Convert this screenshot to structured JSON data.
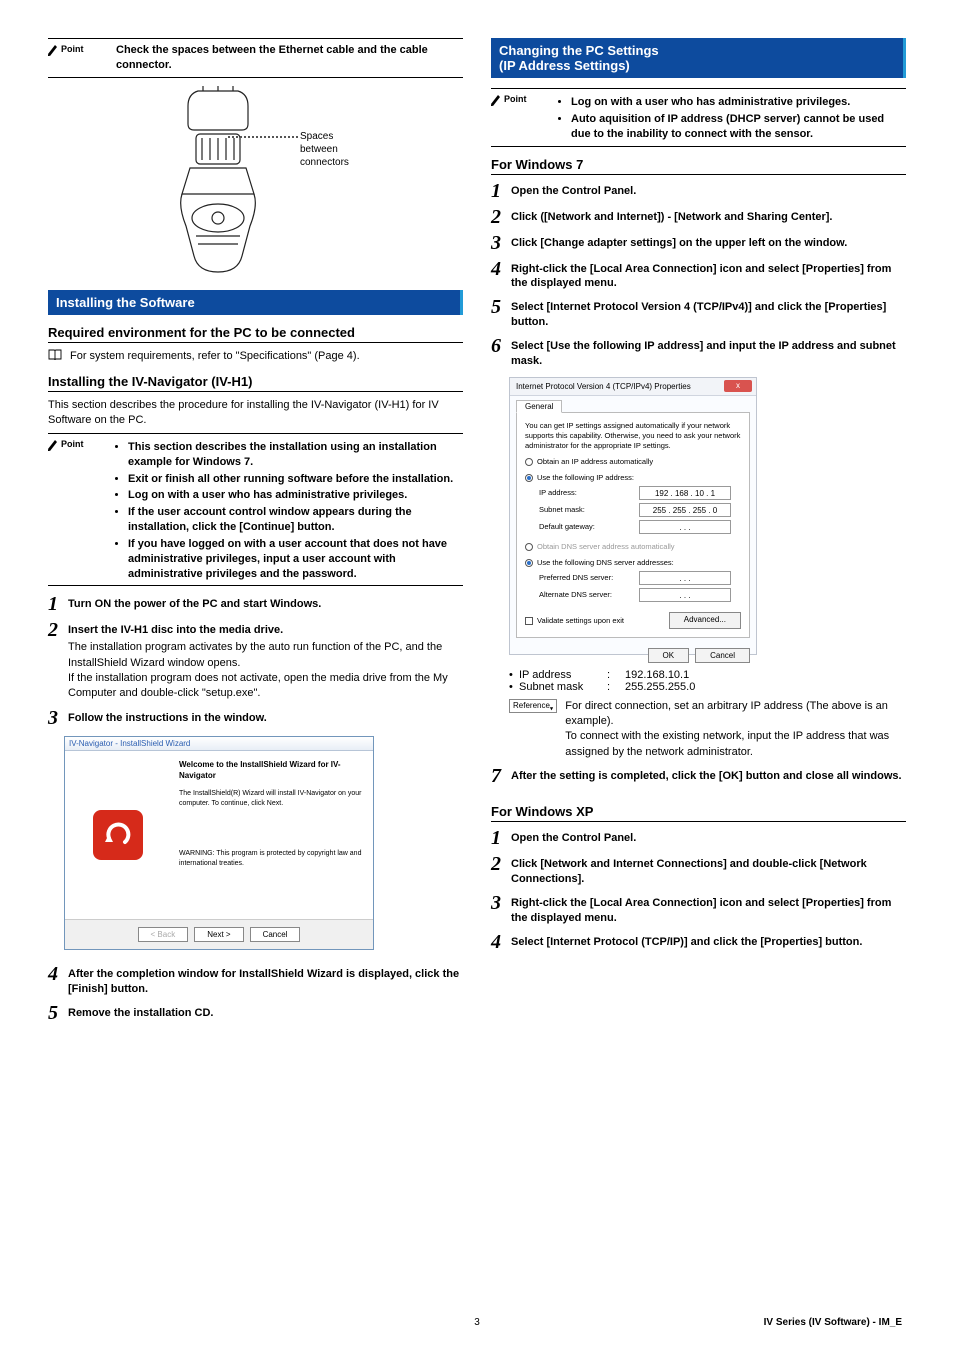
{
  "left": {
    "point1": "Check the spaces between the Ethernet cable and the cable connector.",
    "eth_label_l1": "Spaces between",
    "eth_label_l2": "connectors",
    "section_install": "Installing the Software",
    "sub_req": "Required environment for the PC to be connected",
    "req_text": "For system requirements, refer to \"Specifications\" (Page 4).",
    "sub_nav": "Installing the IV-Navigator (IV-H1)",
    "nav_intro": "This section describes the procedure for installing the IV-Navigator (IV-H1) for IV Software on the PC.",
    "point2_items": [
      "This section describes the installation using an installation example for Windows 7.",
      "Exit or finish all other running software before the installation.",
      "Log on with a user who has administrative privileges.",
      "If the user account control window appears during the installation, click the [Continue] button.",
      "If you have logged on with a user account that does not have administrative privileges, input a user account with administrative privileges and the password."
    ],
    "steps": [
      {
        "n": "1",
        "title": "Turn ON the power of the PC and start Windows."
      },
      {
        "n": "2",
        "title": "Insert the IV-H1 disc into the media drive.",
        "desc": "The installation program activates by the auto run function of the PC, and the InstallShield Wizard window opens.\nIf the installation program does not activate, open the media drive from the My Computer and double-click \"setup.exe\"."
      },
      {
        "n": "3",
        "title": "Follow the instructions in the window."
      },
      {
        "n": "4",
        "title": "After the completion window for InstallShield Wizard is displayed, click the [Finish] button."
      },
      {
        "n": "5",
        "title": "Remove the installation CD."
      }
    ],
    "wizard": {
      "titlebar": "IV-Navigator - InstallShield Wizard",
      "h": "Welcome to the InstallShield Wizard for IV-Navigator",
      "p1": "The InstallShield(R) Wizard will install IV-Navigator on your computer. To continue, click Next.",
      "p2": "WARNING: This program is protected by copyright law and international treaties.",
      "back": "< Back",
      "next": "Next >",
      "cancel": "Cancel"
    }
  },
  "right": {
    "section_pc_l1": "Changing the PC Settings",
    "section_pc_l2": "(IP Address Settings)",
    "point_items": [
      "Log on with a user who has administrative privileges.",
      "Auto aquisition of IP address (DHCP server) cannot be used due to the inability to connect with the sensor."
    ],
    "sub_w7": "For Windows 7",
    "w7_steps": [
      {
        "n": "1",
        "title": "Open the Control Panel."
      },
      {
        "n": "2",
        "title": "Click ([Network and Internet]) - [Network and Sharing Center]."
      },
      {
        "n": "3",
        "title": "Click [Change adapter settings] on the upper left on the window."
      },
      {
        "n": "4",
        "title": "Right-click the [Local Area Connection] icon and select [Properties] from the displayed menu."
      },
      {
        "n": "5",
        "title": "Select [Internet Protocol Version 4 (TCP/IPv4)] and click the [Properties] button."
      },
      {
        "n": "6",
        "title": "Select [Use the following IP address] and input the IP address and subnet mask."
      }
    ],
    "ipv4": {
      "winTitle": "Internet Protocol Version 4 (TCP/IPv4) Properties",
      "close": "x",
      "tab": "General",
      "blurb": "You can get IP settings assigned automatically if your network supports this capability. Otherwise, you need to ask your network administrator for the appropriate IP settings.",
      "r1": "Obtain an IP address automatically",
      "r2": "Use the following IP address:",
      "ip_lbl": "IP address:",
      "ip_val": "192 . 168 .  10 .   1",
      "mask_lbl": "Subnet mask:",
      "mask_val": "255 . 255 . 255 .   0",
      "gw_lbl": "Default gateway:",
      "gw_val": ".       .       .",
      "r3": "Obtain DNS server address automatically",
      "r4": "Use the following DNS server addresses:",
      "dns1_lbl": "Preferred DNS server:",
      "dns2_lbl": "Alternate DNS server:",
      "dns_val": ".       .       .",
      "validate": "Validate settings upon exit",
      "adv": "Advanced...",
      "ok": "OK",
      "cancel": "Cancel"
    },
    "kv": {
      "ip_k": "IP address",
      "ip_v": "192.168.10.1",
      "mask_k": "Subnet mask",
      "mask_v": "255.255.255.0"
    },
    "ref_label": "Reference",
    "ref_text": "For direct connection, set an arbitrary IP address (The above is an example).\nTo connect with the existing network, input the IP address that was assigned by the network administrator.",
    "w7_step7": {
      "n": "7",
      "title": "After the setting is completed, click the [OK] button and close all windows."
    },
    "sub_xp": "For Windows XP",
    "xp_steps": [
      {
        "n": "1",
        "title": "Open the Control Panel."
      },
      {
        "n": "2",
        "title": "Click [Network and Internet Connections] and double-click [Network Connections]."
      },
      {
        "n": "3",
        "title": "Right-click the [Local Area Connection] icon and select [Properties] from the displayed menu."
      },
      {
        "n": "4",
        "title": "Select [Internet Protocol (TCP/IP)] and click the [Properties] button."
      }
    ]
  },
  "point_word": "Point",
  "footer": {
    "page": "3",
    "doc": "IV Series (IV Software) - IM_E"
  }
}
